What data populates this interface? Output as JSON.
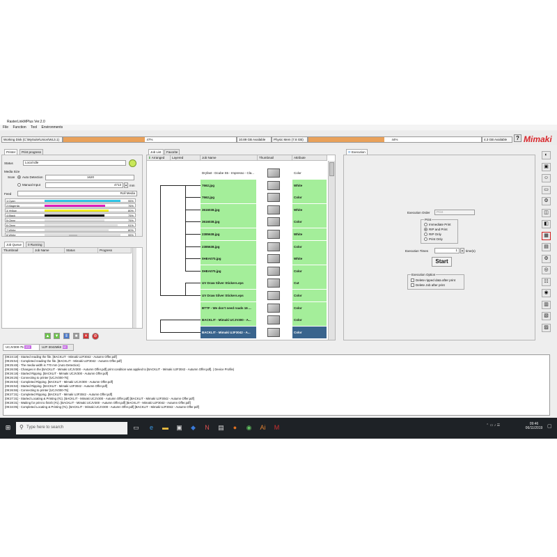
{
  "window": {
    "title": "RasterLinkMPlus Ver.2.0"
  },
  "menu": [
    "File",
    "Function",
    "Tool",
    "Environments"
  ],
  "disks": {
    "working_label": "Working Disk (C:\\MySuite\\Union\\WL3.1)",
    "working_progress": 47,
    "working_progress_text": "47%",
    "working_available": "10.89 GB Available",
    "physical_label": "Physic Mem (7.8 GB)",
    "physical_progress": 44,
    "physical_progress_text": "44%",
    "physical_available": "4.3 GB Available"
  },
  "brand": "Mimaki",
  "help_label": "?",
  "printer_panel": {
    "tabs": [
      "Printer",
      "Print progress"
    ],
    "status_label": "Status",
    "status_value": "Local Idle",
    "media_size_label": "Media Size",
    "scan_label": "Scan",
    "auto_detection": "Auto Detection",
    "auto_detection_value": "1620",
    "manual_input": "Manual Input",
    "manual_value": "4713",
    "unit": "mm",
    "feed_label": "Feed",
    "feed_value": "Roll Media",
    "inks": [
      {
        "name": "1:Cyan",
        "percent": "95%",
        "level": 95,
        "color": "#30c6e8"
      },
      {
        "name": "2:Magenta",
        "percent": "76%",
        "level": 76,
        "color": "#e020c0"
      },
      {
        "name": "3:Yellow",
        "percent": "80%",
        "level": 80,
        "color": "#f3ef20"
      },
      {
        "name": "4:Black",
        "percent": "75%",
        "level": 75,
        "color": "#101010"
      },
      {
        "name": "5:Clear",
        "percent": "75%",
        "level": 75,
        "color": "#dddddd"
      },
      {
        "name": "6:Clear",
        "percent": "91%",
        "level": 91,
        "color": "#dddddd"
      },
      {
        "name": "7:White",
        "percent": "80%",
        "level": 80,
        "color": "#dddddd"
      },
      {
        "name": "8:White",
        "percent": "95%",
        "level": 95,
        "color": "#dddddd"
      }
    ]
  },
  "job_queue": {
    "tabs": [
      "Job Queue",
      "0 Running"
    ],
    "columns": [
      "Thumbnail",
      "Job Name",
      "Status",
      "Progress"
    ]
  },
  "job_list": {
    "tabs": [
      "Job List",
      "Favorite"
    ],
    "columns": [
      "Arranged",
      "Layered",
      "Job Name",
      "Thumbnail",
      "Attribute"
    ],
    "rows": [
      {
        "name": "Dryfast - Dcube S5 - Impresso - Cla...",
        "attr": "Color",
        "style": "plain"
      },
      {
        "name": "7662.jpg",
        "attr": "White",
        "style": "green"
      },
      {
        "name": "7662.jpg",
        "attr": "Color",
        "style": "green"
      },
      {
        "name": "3616038.jpg",
        "attr": "White",
        "style": "green"
      },
      {
        "name": "3616038.jpg",
        "attr": "Color",
        "style": "green"
      },
      {
        "name": "2385638.jpg",
        "attr": "White",
        "style": "green"
      },
      {
        "name": "2385638.jpg",
        "attr": "Color",
        "style": "green"
      },
      {
        "name": "0HEA070.jpg",
        "attr": "White",
        "style": "green"
      },
      {
        "name": "0HEA070.jpg",
        "attr": "Color",
        "style": "green"
      },
      {
        "name": "UV Draw Silver Stickers.eps",
        "attr": "Cut",
        "style": "green"
      },
      {
        "name": "UV Draw Silver Stickers.eps",
        "attr": "Color",
        "style": "green"
      },
      {
        "name": "BTTF - We don't need roads 16 ...",
        "attr": "Color",
        "style": "green"
      },
      {
        "name": "BACKLIT - Mimaki UCJV300 - A...",
        "attr": "Color",
        "style": "green"
      },
      {
        "name": "BACKLIT - Mimaki UJF3042 - A...",
        "attr": "Color",
        "style": "selected"
      }
    ]
  },
  "execution": {
    "tab": "Execution",
    "order_label": "Execution Order",
    "order_value": "Print",
    "print_group": "Print",
    "options": [
      "Immediate Print",
      "RIP and Print",
      "RIP Only",
      "Print Only"
    ],
    "selected_option": 1,
    "times_label": "Execution Times",
    "times_value": "1",
    "times_unit": "time(s)",
    "start_label": "Start",
    "after_group": "Execution Option",
    "after_options": [
      "Delete ripped data after print",
      "Delete Job after print"
    ]
  },
  "printers": [
    "UCJV300-75",
    "UJF-3042MkII"
  ],
  "log": [
    "[09:24:18] - Started reading the file. [BACKLIT - Mimaki UJF3042 - Autumn Offer.pdf]",
    "[09:25:54] - Completed reading the file. [BACKLIT - Mimaki UJF3042 - Autumn Offer.pdf]",
    "[09:25:48] - The media width is 770 mm (Auto Detection)",
    "[09:26:08] - Changes in the [BACKLIT - Mimaki UCJV300 - Autumn Offer.pdf] print condition was applied to [BACKLIT - Mimaki UJF3042 - Autumn Offer.pdf]. ( Device Profile)",
    "[09:26:18] - Started Ripping. [BACKLIT - Mimaki UCJV300 - Autumn Offer.pdf]",
    "[09:26:25] - Connecting to printer [UCJV300-75]",
    "[09:26:53] - Completed Ripping. [BACKLIT - Mimaki UCJV300 - Autumn Offer.pdf]",
    "[09:26:53] - Started Ripping. [BACKLIT - Mimaki UJF3042 - Autumn Offer.pdf]",
    "[09:26:55] - Connecting to printer [UCJV300-75]",
    "[09:27:31] - Completed Ripping. [BACKLIT - Mimaki UJF3042 - Autumn Offer.pdf]",
    "[09:27:31] - Started Locating & Printing (#1). [BACKLIT - Mimaki UCJV300 - Autumn Offer.pdf] [BACKLIT - Mimaki UJF3042 - Autumn Offer.pdf]",
    "[09:28:31] - Waiting for print to finish (#1). [BACKLIT - Mimaki UCJV300 - Autumn Offer.pdf] [BACKLIT - Mimaki UJF3042 - Autumn Offer.pdf]",
    "[09:34:05] - Completed Locating & Printing (#1). [BACKLIT - Mimaki UCJV300 - Autumn Offer.pdf] [BACKLIT - Mimaki UJF3042 - Autumn Offer.pdf]"
  ],
  "taskbar": {
    "search_placeholder": "Type here to search",
    "time": "09:46",
    "date": "06/11/2019"
  }
}
